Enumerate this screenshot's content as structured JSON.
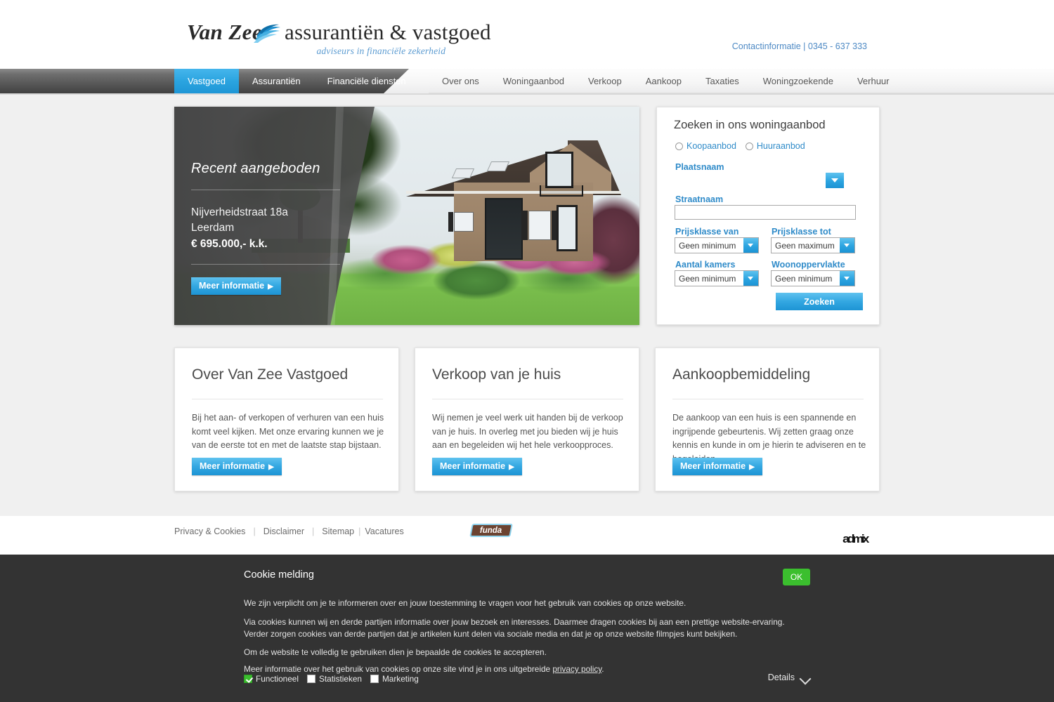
{
  "header": {
    "logo": {
      "name_italic": "Van Zee",
      "name_rest": "assurantiën & vastgoed",
      "tagline": "adviseurs in financiële zekerheid",
      "swoosh_icon": "wave-swoosh-icon",
      "accent_color": "#2ba4e0"
    },
    "contact": "Contactinformatie  |  0345 - 637 333"
  },
  "nav": {
    "primary": [
      {
        "label": "Vastgoed",
        "active": true
      },
      {
        "label": "Assurantiën",
        "active": false
      },
      {
        "label": "Financiële diensten",
        "active": false
      }
    ],
    "secondary": [
      {
        "label": "Over ons"
      },
      {
        "label": "Woningaanbod"
      },
      {
        "label": "Verkoop"
      },
      {
        "label": "Aankoop"
      },
      {
        "label": "Taxaties"
      },
      {
        "label": "Woningzoekende"
      },
      {
        "label": "Verhuur"
      }
    ]
  },
  "hero": {
    "title": "Recent aangeboden",
    "address_street": "Nijverheidstraat 18a",
    "address_city": "Leerdam",
    "price": "€ 695.000,- k.k.",
    "button_label": "Meer informatie",
    "button_arrow": "▶",
    "photo_alt": "brick house with dark tiled roof, green lawn and flowering shrubs"
  },
  "search": {
    "title": "Zoeken in ons woningaanbod",
    "radios": [
      {
        "label": "Koopaanbod",
        "checked": false
      },
      {
        "label": "Huuraanbod",
        "checked": false
      }
    ],
    "place_label": "Plaatsnaam",
    "place_value": "",
    "street_label": "Straatnaam",
    "street_value": "",
    "price_from_label": "Prijsklasse van",
    "price_from_value": "Geen minimum",
    "price_to_label": "Prijsklasse tot",
    "price_to_value": "Geen maximum",
    "rooms_label": "Aantal kamers",
    "rooms_value": "Geen minimum",
    "area_label": "Woonoppervlakte",
    "area_value": "Geen minimum",
    "submit_label": "Zoeken"
  },
  "cards": [
    {
      "title": "Over Van Zee Vastgoed",
      "body": "Bij het aan- of verkopen of verhuren van een huis komt veel kijken. Met onze ervaring kunnen we je van de eerste tot en met de laatste stap bijstaan.",
      "button_label": "Meer informatie",
      "button_arrow": "▶"
    },
    {
      "title": "Verkoop van je huis",
      "body": "Wij nemen je veel werk uit handen bij de verkoop van je huis. In overleg met jou bieden wij je huis aan en begeleiden wij het hele verkoopproces.",
      "button_label": "Meer informatie",
      "button_arrow": "▶"
    },
    {
      "title": "Aankoopbemiddeling",
      "body": "De aankoop van een huis is een spannende en ingrijpende gebeurtenis. Wij zetten graag onze kennis en kunde in om je hierin te adviseren en te begeleiden.",
      "button_label": "Meer informatie",
      "button_arrow": "▶"
    }
  ],
  "footer": {
    "links": [
      {
        "label": "Privacy & Cookies"
      },
      {
        "label": "Disclaimer"
      },
      {
        "label": "Sitemap"
      },
      {
        "label": "Vacatures"
      }
    ],
    "funda_label": "funda",
    "admix_label": "admix"
  },
  "cookie": {
    "title": "Cookie melding",
    "ok_label": "OK",
    "p1": "We zijn verplicht om je te informeren over en jouw toestemming te vragen voor het gebruik van cookies op onze website.",
    "p2": "Via cookies kunnen wij en derde partijen informatie over jouw bezoek en interesses. Daarmee dragen cookies bij aan een prettige website-ervaring. Verder zorgen cookies van derde partijen dat je artikelen kunt delen via sociale media en dat je op onze website filmpjes kunt bekijken.",
    "p3": "Om de website te volledig te gebruiken dien je bepaalde de cookies te accepteren.",
    "p4_pre": "Meer informatie over het gebruik van cookies op onze site vind je in ons uitgebreide ",
    "p4_link": "privacy policy",
    "p4_post": ".",
    "checkboxes": [
      {
        "label": "Functioneel",
        "checked": true
      },
      {
        "label": "Statistieken",
        "checked": false
      },
      {
        "label": "Marketing",
        "checked": false
      }
    ],
    "details_label": "Details",
    "details_icon": "chevron-down-icon"
  }
}
